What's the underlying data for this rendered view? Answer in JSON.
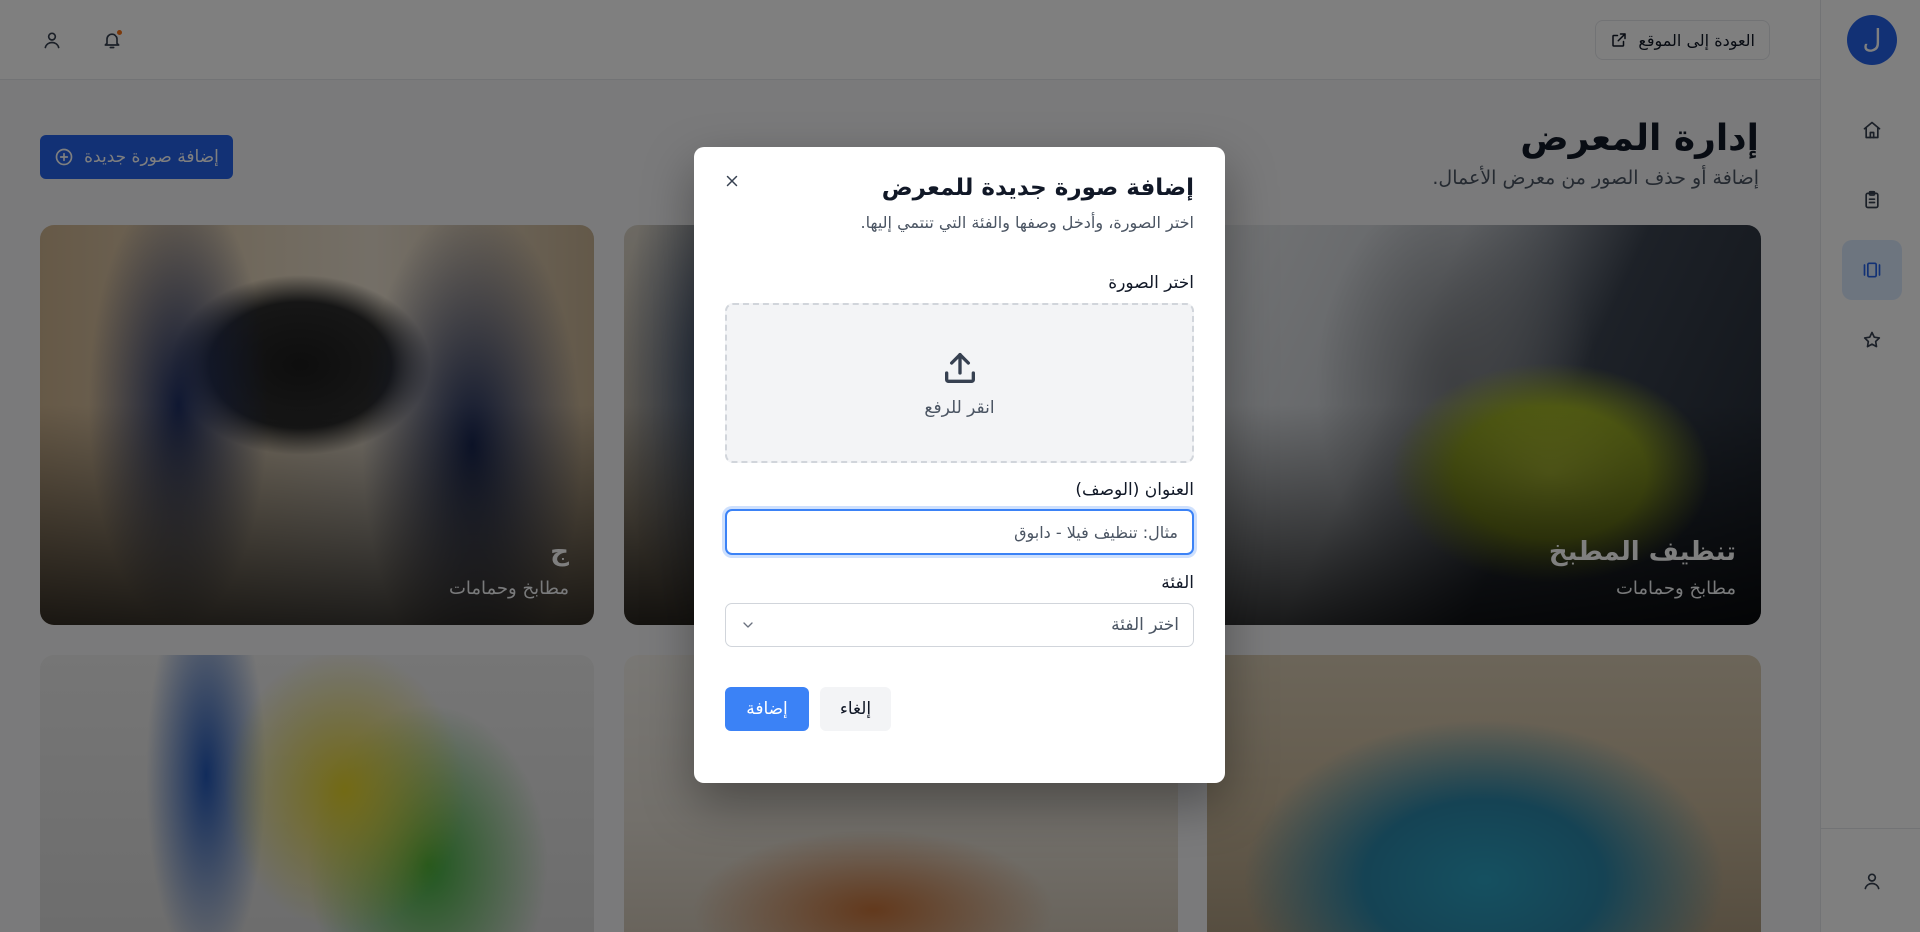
{
  "app": {
    "brand_letter": "ل",
    "accent_color": "#2563eb"
  },
  "header": {
    "back_label": "العودة إلى الموقع"
  },
  "sidebar": {
    "items": [
      {
        "icon": "home-icon"
      },
      {
        "icon": "clipboard-icon"
      },
      {
        "icon": "gallery-icon",
        "active": true
      },
      {
        "icon": "star-icon"
      }
    ],
    "footer_icon": "user-icon"
  },
  "page": {
    "title": "إدارة المعرض",
    "subtitle": "إضافة أو حذف الصور من معرض الأعمال.",
    "add_button_label": "إضافة صورة جديدة"
  },
  "gallery": {
    "cards": [
      {
        "title": "تنظيف المطبخ",
        "category": "مطابخ وحمامات"
      },
      {
        "title": "",
        "category": ""
      },
      {
        "title": "ج",
        "category": "مطابخ وحمامات"
      },
      {
        "title": "",
        "category": ""
      },
      {
        "title": "",
        "category": ""
      },
      {
        "title": "",
        "category": ""
      }
    ]
  },
  "modal": {
    "title": "إضافة صورة جديدة للمعرض",
    "subtitle": "اختر الصورة، وأدخل وصفها والفئة التي تنتمي إليها.",
    "image_label": "اختر الصورة",
    "upload_text": "انقر للرفع",
    "title_label": "العنوان (الوصف)",
    "title_placeholder": "مثال: تنظيف فيلا - دابوق",
    "title_value": "",
    "category_label": "الفئة",
    "category_placeholder": "اختر الفئة",
    "submit_label": "إضافة",
    "cancel_label": "إلغاء"
  }
}
